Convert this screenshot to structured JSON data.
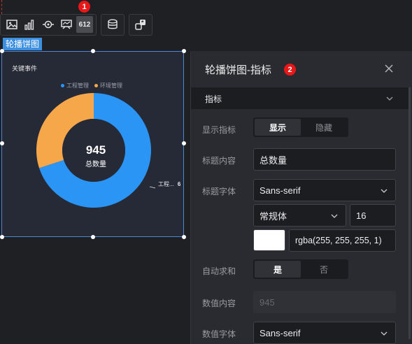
{
  "toolbar": {
    "groups": [
      {
        "icons": [
          "image-icon",
          "bar-chart-icon",
          "target-icon",
          "map-icon"
        ],
        "number_button": "612"
      },
      {
        "icons": [
          "database-icon"
        ]
      },
      {
        "icons": [
          "share-icon"
        ]
      }
    ],
    "badge1": "1"
  },
  "component": {
    "tag": "轮播饼图"
  },
  "chart_card": {
    "title": "关键事件",
    "center_value": "945",
    "center_label": "总数量",
    "slice_label_name": "工程...",
    "slice_label_value": "6"
  },
  "chart_data": {
    "type": "pie",
    "title": "关键事件",
    "categories": [
      "工程管理",
      "环境管理"
    ],
    "values": [
      70,
      30
    ],
    "colors": [
      "#2a95f5",
      "#f5a74a"
    ],
    "center": {
      "value": "945",
      "label": "总数量"
    },
    "legend_position": "top"
  },
  "panel": {
    "title": "轮播饼图-指标",
    "badge2": "2",
    "section": "指标",
    "rows": {
      "show_indicator": {
        "label": "显示指标",
        "options": [
          "显示",
          "隐藏"
        ],
        "selected": 0
      },
      "title_content": {
        "label": "标题内容",
        "value": "总数量"
      },
      "title_font": {
        "label": "标题字体",
        "family": "Sans-serif",
        "weight": "常规体",
        "size": "16",
        "color": "rgba(255, 255, 255, 1)"
      },
      "auto_sum": {
        "label": "自动求和",
        "options": [
          "是",
          "否"
        ],
        "selected": 0
      },
      "value_content": {
        "label": "数值内容",
        "placeholder": "945"
      },
      "value_font": {
        "label": "数值字体",
        "family": "Sans-serif"
      }
    }
  },
  "colors": {
    "accent": "#3d8fe0",
    "badge": "#e81818",
    "blue_slice": "#2a95f5",
    "orange_slice": "#f5a74a"
  }
}
